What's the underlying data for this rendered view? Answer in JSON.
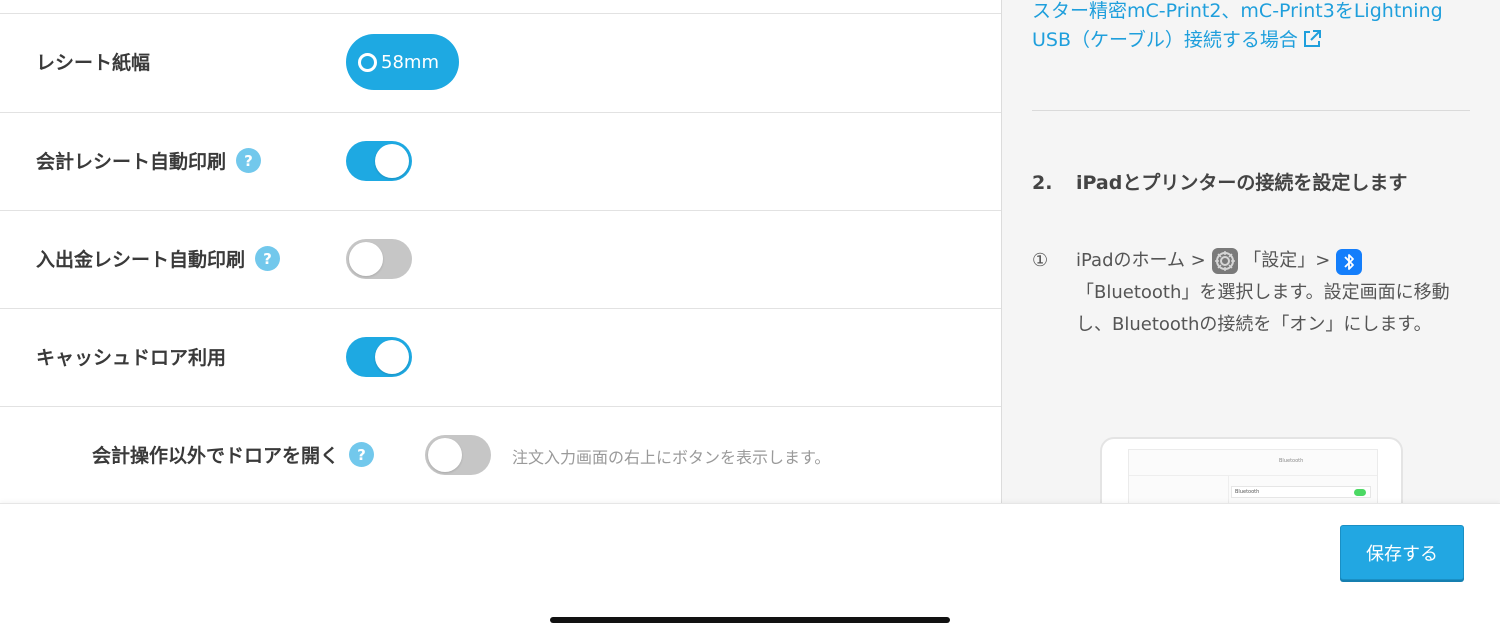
{
  "settings": {
    "paper_width": {
      "label": "レシート紙幅",
      "option": "58mm"
    },
    "auto_print_receipt": {
      "label": "会計レシート自動印刷",
      "help": "?",
      "enabled": true
    },
    "auto_print_cash": {
      "label": "入出金レシート自動印刷",
      "help": "?",
      "enabled": false
    },
    "cash_drawer": {
      "label": "キャッシュドロア利用",
      "enabled": true
    },
    "open_drawer": {
      "label": "会計操作以外でドロアを開く",
      "help": "?",
      "enabled": false,
      "hint": "注文入力画面の右上にボタンを表示します。"
    }
  },
  "help_panel": {
    "link_line1": "スター精密mC-Print2、mC-Print3をLightning",
    "link_line2": "USB（ケーブル）接続する場合",
    "step2": {
      "number": "2.",
      "title": "iPadとプリンターの接続を設定します"
    },
    "sub_step": {
      "marker": "①",
      "text_a": "iPadのホーム > ",
      "text_b": "「設定」> ",
      "text_c": "「Bluetooth」を選択します。設定画面に移動し、Bluetoothの接続を「オン」にします。"
    },
    "ipad_image": {
      "top_label": "Bluetooth",
      "row_label": "Bluetooth"
    }
  },
  "footer": {
    "save_label": "保存する"
  },
  "colors": {
    "accent": "#1ea9e2",
    "toggle_off": "#c6c6c6",
    "link": "#1f9fdc",
    "help_icon": "#72c8ec"
  }
}
